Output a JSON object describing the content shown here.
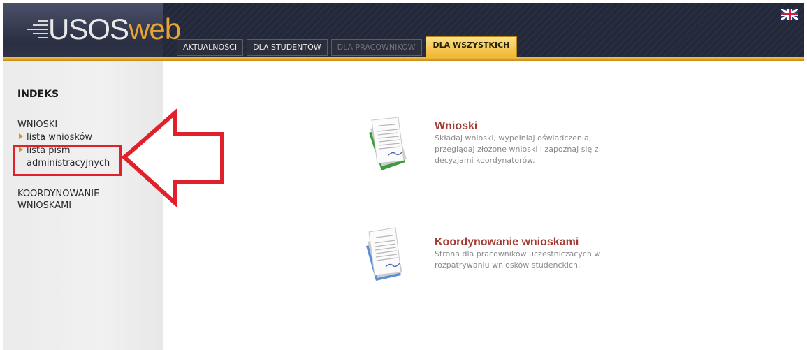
{
  "app": {
    "logo_text_a": "USOS",
    "logo_text_b": "web"
  },
  "header": {
    "tabs": [
      {
        "label": "AKTUALNOŚCI",
        "state": "normal"
      },
      {
        "label": "DLA STUDENTÓW",
        "state": "normal"
      },
      {
        "label": "DLA PRACOWNIKÓW",
        "state": "disabled"
      },
      {
        "label": "DLA WSZYSTKICH",
        "state": "active"
      }
    ],
    "language_flag": "uk-flag-icon"
  },
  "sidebar": {
    "title": "INDEKS",
    "section_wnioski": "WNIOSKI",
    "links": [
      {
        "label": "lista wniosków"
      },
      {
        "label_line1": "lista pism",
        "label_line2": "administracyjnych"
      }
    ],
    "section_koordynowanie_line1": "KOORDYNOWANIE",
    "section_koordynowanie_line2": "WNIOSKAMI"
  },
  "main": {
    "cards": [
      {
        "icon": "document-green-icon",
        "title": "Wnioski",
        "desc_lines": [
          "Składaj wnioski, wypełniaj oświadczenia,",
          "przeglądaj złożone wnioski i zapoznaj się z",
          "decyzjami koordynatorów."
        ]
      },
      {
        "icon": "document-blue-icon",
        "title": "Koordynowanie wnioskami",
        "desc_lines": [
          "Strona dla pracownikow uczestniczacych w",
          "rozpatrywaniu wniosków studenckich."
        ]
      }
    ]
  },
  "colors": {
    "header_bg": "#23283a",
    "accent_gold": "#f1b733",
    "title_red": "#a23a32",
    "annotation_red": "#e0202a"
  }
}
